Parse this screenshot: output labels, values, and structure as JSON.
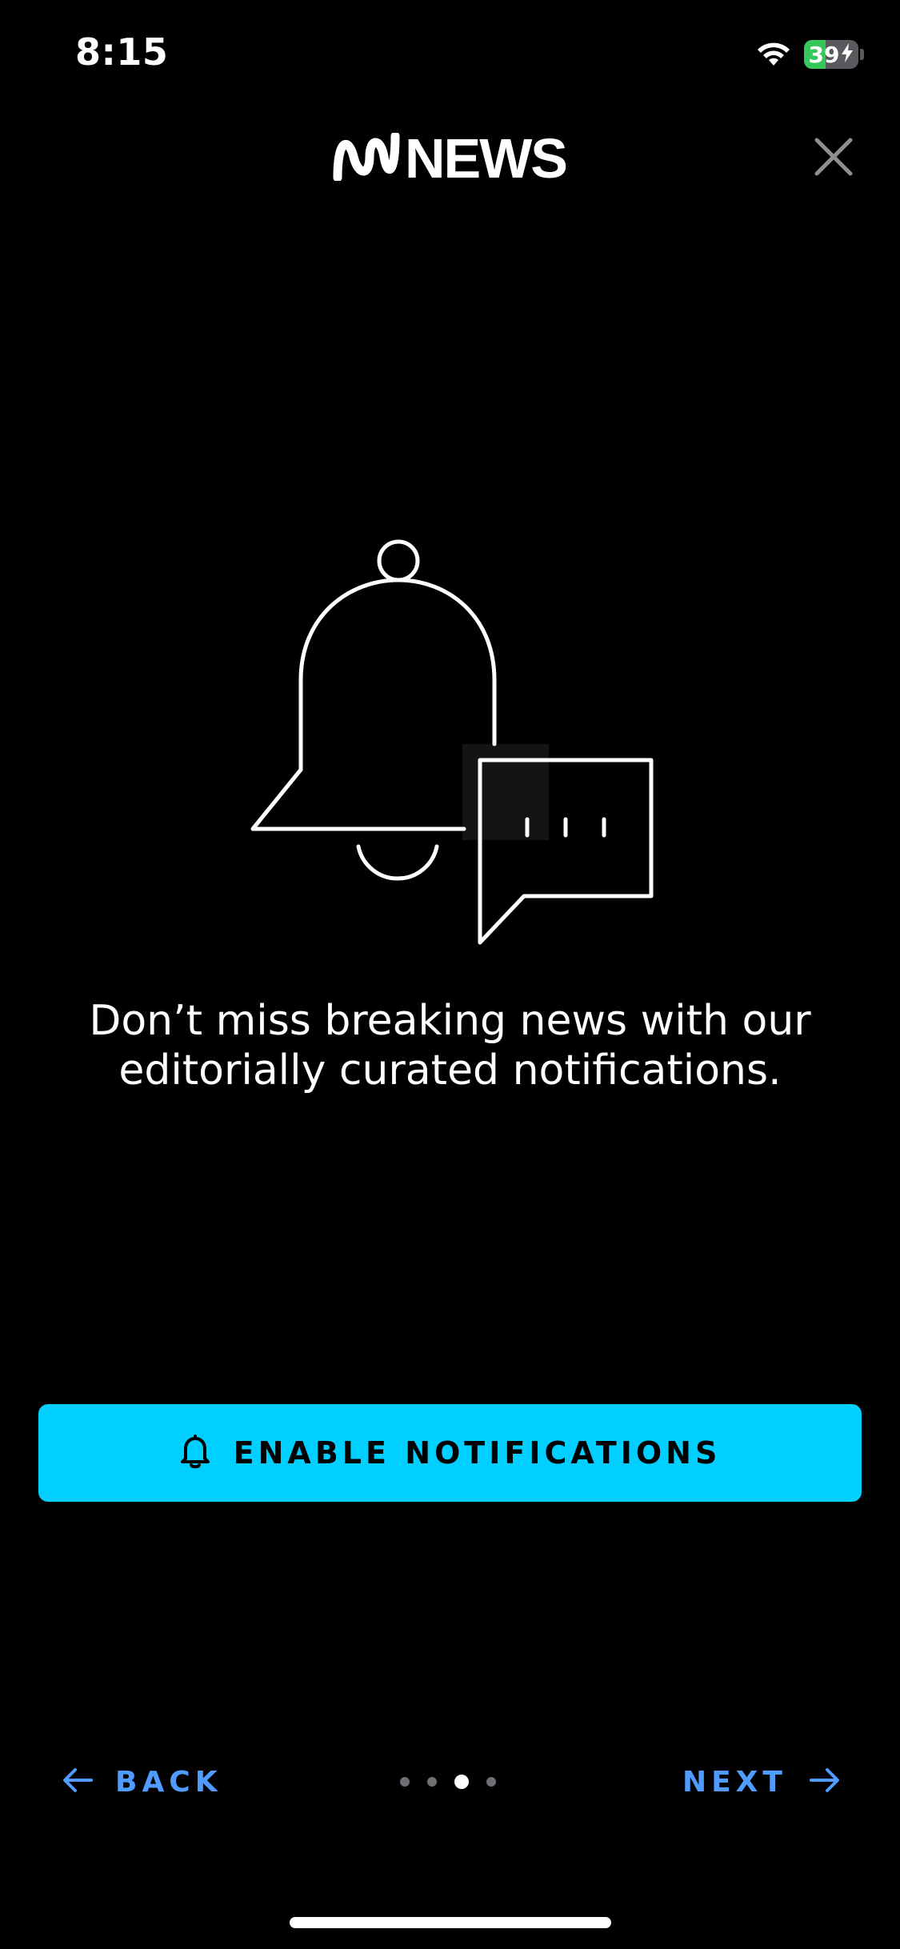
{
  "status_bar": {
    "time": "8:15",
    "battery_level": "39",
    "battery_fraction": 0.39,
    "wifi_icon": "wifi-icon",
    "charging_icon": "bolt-icon"
  },
  "header": {
    "logo_text": "NEWS",
    "logo_mark_icon": "abc-lissajous-icon",
    "close_icon": "close-icon"
  },
  "onboarding": {
    "illustration_icon": "bell-with-speech-bubble-icon",
    "message": "Don’t miss breaking news with our editorially curated notifications.",
    "cta_label": "ENABLE NOTIFICATIONS",
    "cta_icon": "bell-icon"
  },
  "navigation": {
    "back_label": "BACK",
    "next_label": "NEXT",
    "page_count": 4,
    "current_page": 3
  },
  "colors": {
    "background": "#000000",
    "accent": "#00cfff",
    "nav_link": "#4f9bff",
    "battery_green": "#34c759"
  }
}
